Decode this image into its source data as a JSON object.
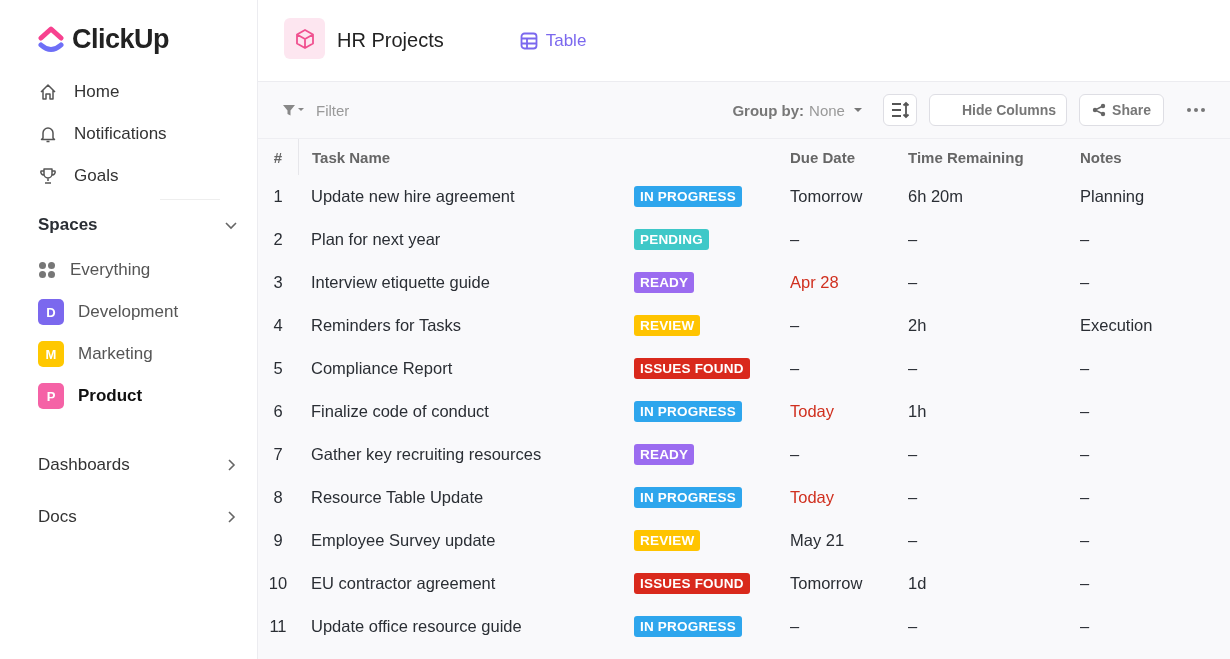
{
  "sidebar": {
    "logo": "ClickUp",
    "nav": [
      {
        "label": "Home"
      },
      {
        "label": "Notifications"
      },
      {
        "label": "Goals"
      }
    ],
    "spaces_title": "Spaces",
    "spaces_expanded": true,
    "spaces": [
      {
        "label": "Everything",
        "kind": "all",
        "selected": false
      },
      {
        "label": "Development",
        "kind": "space",
        "letter": "D",
        "color": "#7b68ee",
        "selected": false
      },
      {
        "label": "Marketing",
        "kind": "space",
        "letter": "M",
        "color": "#ffc800",
        "selected": false
      },
      {
        "label": "Product",
        "kind": "space",
        "letter": "P",
        "color": "#f562a6",
        "selected": true
      }
    ],
    "sections": [
      {
        "label": "Dashboards",
        "expanded": false
      },
      {
        "label": "Docs",
        "expanded": false
      }
    ]
  },
  "header": {
    "title": "HR Projects",
    "view_tab": {
      "label": "Table",
      "selected": true
    }
  },
  "toolbar": {
    "filter": "Filter",
    "group_by_label": "Group by:",
    "group_by_value": "None",
    "hide_columns": "Hide Columns",
    "share": "Share"
  },
  "table": {
    "columns": [
      "#",
      "Task Name",
      "Due Date",
      "Time Remaining",
      "Notes"
    ],
    "rows": [
      {
        "num": "1",
        "task": "Update new hire agreement",
        "status": "IN PROGRESS",
        "color": "#2ea6ed",
        "due": "Tomorrow",
        "due_urgent": false,
        "time": "6h 20m",
        "notes": "Planning"
      },
      {
        "num": "2",
        "task": "Plan for next year",
        "status": "PENDING",
        "color": "#3fc8c8",
        "due": "–",
        "due_urgent": false,
        "time": "–",
        "notes": "–"
      },
      {
        "num": "3",
        "task": "Interview etiquette guide",
        "status": "READY",
        "color": "#9b6cf0",
        "due": "Apr 28",
        "due_urgent": true,
        "time": "–",
        "notes": "–"
      },
      {
        "num": "4",
        "task": "Reminders for Tasks",
        "status": "REVIEW",
        "color": "#ffc400",
        "due": "–",
        "due_urgent": false,
        "time": "2h",
        "notes": "Execution"
      },
      {
        "num": "5",
        "task": "Compliance Report",
        "status": "ISSUES FOUND",
        "color": "#d9291c",
        "due": "–",
        "due_urgent": false,
        "time": "–",
        "notes": "–"
      },
      {
        "num": "6",
        "task": "Finalize code of conduct",
        "status": "IN PROGRESS",
        "color": "#2ea6ed",
        "due": "Today",
        "due_urgent": true,
        "time": "1h",
        "notes": "–"
      },
      {
        "num": "7",
        "task": "Gather key recruiting resources",
        "status": "READY",
        "color": "#9b6cf0",
        "due": "–",
        "due_urgent": false,
        "time": "–",
        "notes": "–"
      },
      {
        "num": "8",
        "task": "Resource Table Update",
        "status": "IN PROGRESS",
        "color": "#2ea6ed",
        "due": "Today",
        "due_urgent": true,
        "time": "–",
        "notes": "–"
      },
      {
        "num": "9",
        "task": "Employee Survey update",
        "status": "REVIEW",
        "color": "#ffc400",
        "due": "May 21",
        "due_urgent": false,
        "time": "–",
        "notes": "–"
      },
      {
        "num": "10",
        "task": "EU contractor agreement",
        "status": "ISSUES FOUND",
        "color": "#d9291c",
        "due": "Tomorrow",
        "due_urgent": false,
        "time": "1d",
        "notes": "–"
      },
      {
        "num": "11",
        "task": "Update office resource guide",
        "status": "IN PROGRESS",
        "color": "#2ea6ed",
        "due": "–",
        "due_urgent": false,
        "time": "–",
        "notes": "–"
      }
    ]
  }
}
